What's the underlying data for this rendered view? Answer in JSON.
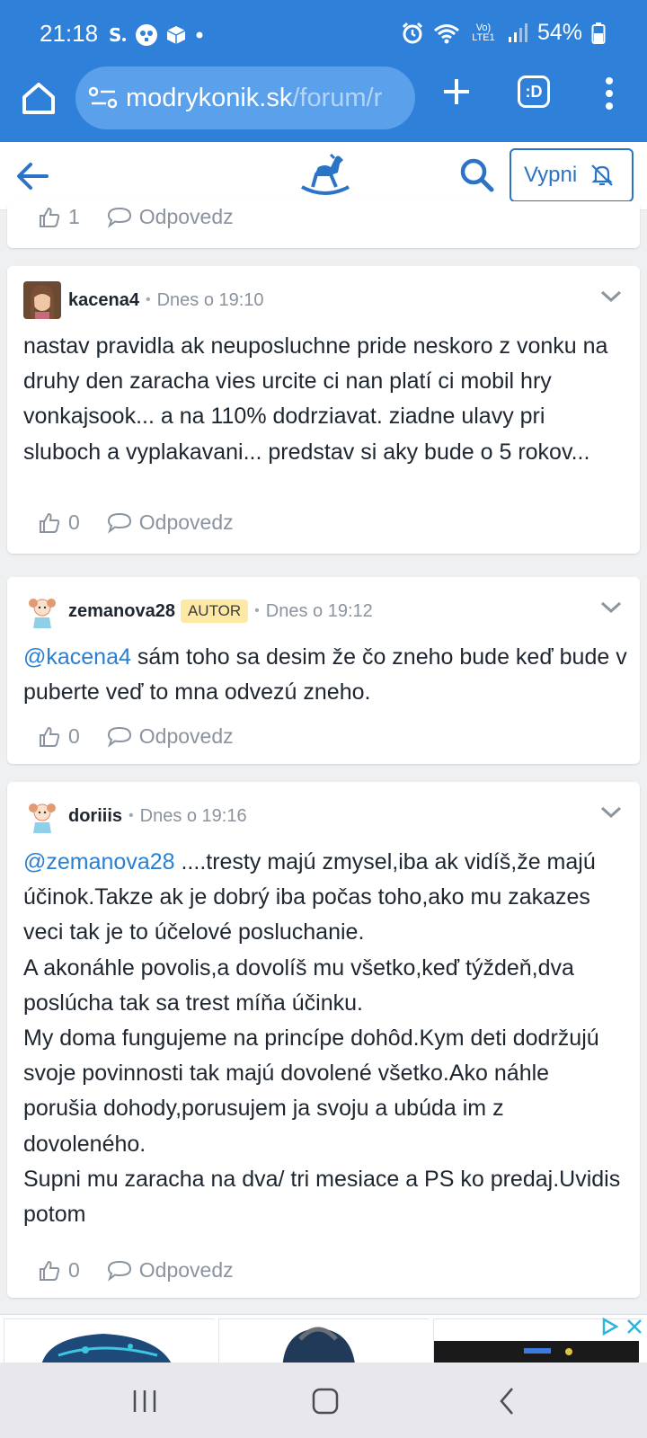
{
  "status": {
    "time": "21:18",
    "battery": "54%",
    "network": "Vo) LTE1"
  },
  "browser": {
    "url_host": "modrykonik.sk",
    "url_path": "/forum/r",
    "tabs_label": ":D"
  },
  "site": {
    "mute_label": "Vypni",
    "icons": [
      "back-arrow-icon",
      "rocking-horse-logo",
      "search-icon",
      "bell-off-icon"
    ]
  },
  "posts": [
    {
      "likes": "1",
      "reply_label": "Odpovedz"
    },
    {
      "author": "kacena4",
      "time": "Dnes o 19:10",
      "text": "nastav pravidla ak neuposluchne pride neskoro z vonku na druhy den zaracha vies urcite ci nan platí ci mobil hry vonkajsook... a na 110% dodrziavat. ziadne ulavy pri sluboch a vyplakavani... predstav si aky bude o 5 rokov...",
      "likes": "0",
      "reply_label": "Odpovedz"
    },
    {
      "author": "zemanova28",
      "badge": "AUTOR",
      "time": "Dnes o 19:12",
      "mention": "@kacena4",
      "text": " sám toho sa desim že čo zneho bude keď bude v puberte veď to mna odvezú zneho.",
      "likes": "0",
      "reply_label": "Odpovedz"
    },
    {
      "author": "doriiis",
      "time": "Dnes o 19:16",
      "mention": "@zemanova28",
      "text": " ....tresty majú zmysel,iba ak vidíš,že majú účinok.Takze ak je dobrý iba počas toho,ako mu zakazes veci tak je to účelové posluchanie.\nA akonáhle povolis,a dovolíš mu všetko,keď týždeň,dva poslúcha tak sa trest míňa účinku.\nMy doma fungujeme na princípe dohôd.Kym deti dodržujú svoje povinnosti tak majú dovolené všetko.Ako náhle porušia dohody,porusujem ja svoju a ubúda im z dovoleného.\nSupni mu zaracha na dva/ tri mesiace a PS ko predaj.Uvidis potom",
      "likes": "0",
      "reply_label": "Odpovedz"
    }
  ],
  "colors": {
    "browser_blue": "#2f80d9",
    "link_blue": "#2b7fd1",
    "badge_yellow": "#fde9a4"
  }
}
